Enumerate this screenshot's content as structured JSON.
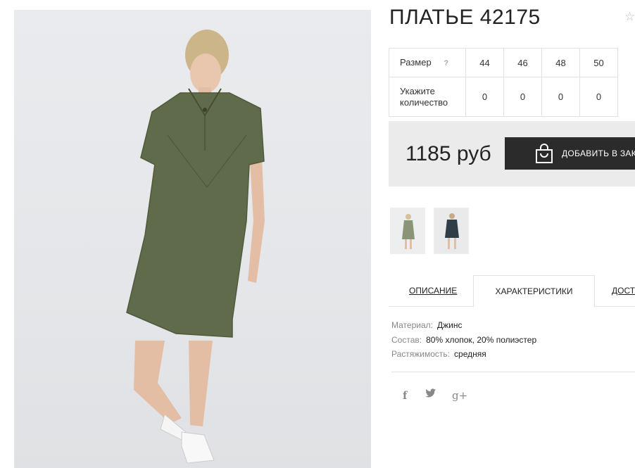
{
  "product": {
    "title": "ПЛАТЬЕ 42175",
    "favorite_icon": "star-icon"
  },
  "size_table": {
    "size_label": "Размер",
    "help_symbol": "?",
    "qty_label": "Укажите количество",
    "sizes": [
      "44",
      "46",
      "48",
      "50"
    ],
    "quantities": [
      "0",
      "0",
      "0",
      "0"
    ]
  },
  "pricing": {
    "price": "1185 руб",
    "cart_button_label": "ДОБАВИТЬ В ЗАКАЗ",
    "cart_icon": "shopping-bag-icon"
  },
  "thumbnails": [
    {
      "name": "olive-dress-front",
      "color": "#5f6b4a"
    },
    {
      "name": "navy-dress-front",
      "color": "#2e3d48"
    }
  ],
  "tabs": {
    "description": "ОПИСАНИЕ",
    "characteristics": "ХАРАКТЕРИСТИКИ",
    "delivery": "ДОСТАВКА",
    "active": "characteristics"
  },
  "specs": [
    {
      "key": "Материал:",
      "value": "Джинс"
    },
    {
      "key": "Состав:",
      "value": "80% хлопок, 20% полиэстер"
    },
    {
      "key": "Растяжимость:",
      "value": "средняя"
    }
  ],
  "social": {
    "facebook": "f",
    "twitter": "twitter-icon",
    "googleplus": "g+"
  },
  "colors": {
    "dress_olive": "#5f6b4a",
    "dark_button": "#2b2b2b",
    "price_bg": "#ebebeb"
  }
}
